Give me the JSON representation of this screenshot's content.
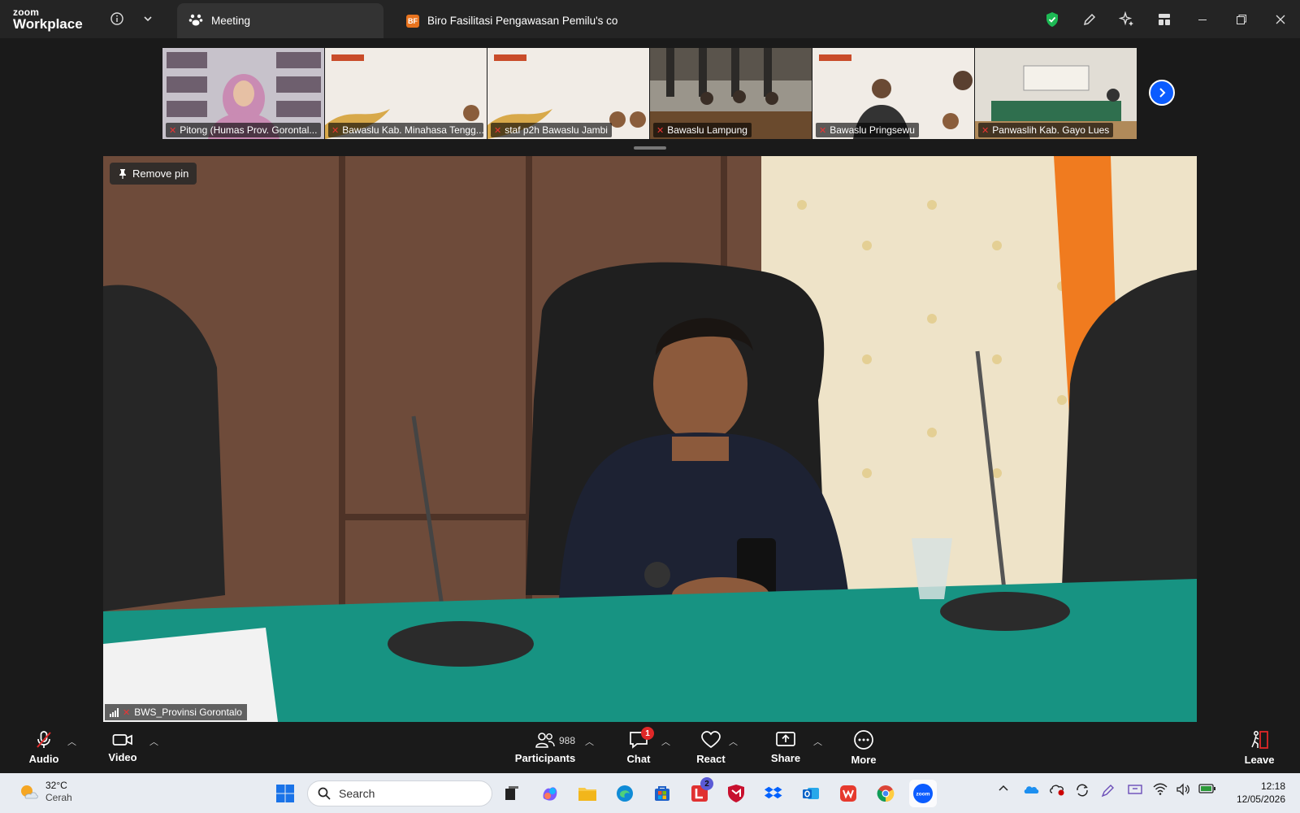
{
  "app": {
    "brand_small": "zoom",
    "brand_big": "Workplace"
  },
  "tabs": [
    {
      "label": "Meeting",
      "icon": "paw-icon",
      "active": true
    },
    {
      "label": "Biro Fasilitasi Pengawasan Pemilu's co",
      "badge": "BF",
      "active": false
    }
  ],
  "gallery": [
    {
      "label": "Pitong (Humas Prov. Gorontal..."
    },
    {
      "label": "Bawaslu Kab. Minahasa Tengg..."
    },
    {
      "label": "staf p2h Bawaslu Jambi"
    },
    {
      "label": "Bawaslu Lampung"
    },
    {
      "label": "Bawaslu Pringsewu"
    },
    {
      "label": "Panwaslih Kab. Gayo Lues"
    }
  ],
  "main": {
    "pin_label": "Remove pin",
    "speaker_label": "BWS_Provinsi Gorontalo"
  },
  "toolbar": {
    "audio": "Audio",
    "video": "Video",
    "participants": "Participants",
    "participants_count": "988",
    "chat": "Chat",
    "chat_badge": "1",
    "react": "React",
    "share": "Share",
    "more": "More",
    "leave": "Leave"
  },
  "taskbar": {
    "temperature": "32°C",
    "condition": "Cerah",
    "search_placeholder": "Search",
    "teams_badge": "2",
    "time": "12:18",
    "date": "12/05/2026"
  },
  "colors": {
    "accent": "#0b5cff",
    "danger": "#e02828",
    "shield": "#1db954"
  }
}
